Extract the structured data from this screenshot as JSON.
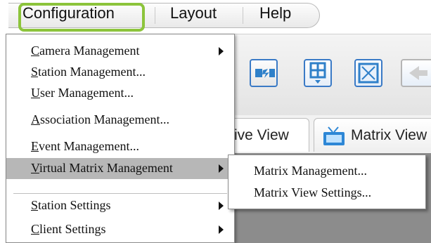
{
  "menubar": {
    "items": [
      {
        "label": "Configuration"
      },
      {
        "label": "Layout"
      },
      {
        "label": "Help"
      }
    ]
  },
  "configuration_menu": {
    "items": [
      {
        "label": "Camera Management",
        "submenu": true
      },
      {
        "label": "Station Management...",
        "submenu": false
      },
      {
        "label": "User Management...",
        "submenu": false
      },
      {
        "label": "Association Management...",
        "submenu": false
      },
      {
        "label": "Event Management...",
        "submenu": false
      },
      {
        "label": "Virtual Matrix Management",
        "submenu": true,
        "selected": true
      },
      {
        "label": "Station Settings",
        "submenu": true
      },
      {
        "label": "Client Settings",
        "submenu": true
      }
    ]
  },
  "virtual_matrix_submenu": {
    "items": [
      {
        "label": "Matrix Management..."
      },
      {
        "label": "Matrix View Settings..."
      }
    ]
  },
  "tabs": {
    "live_view": "ive View",
    "matrix_view": "Matrix View"
  },
  "colors": {
    "highlight": "#8cc43b",
    "accent": "#3a7ac6",
    "selected_bg": "#b7b7b7"
  }
}
